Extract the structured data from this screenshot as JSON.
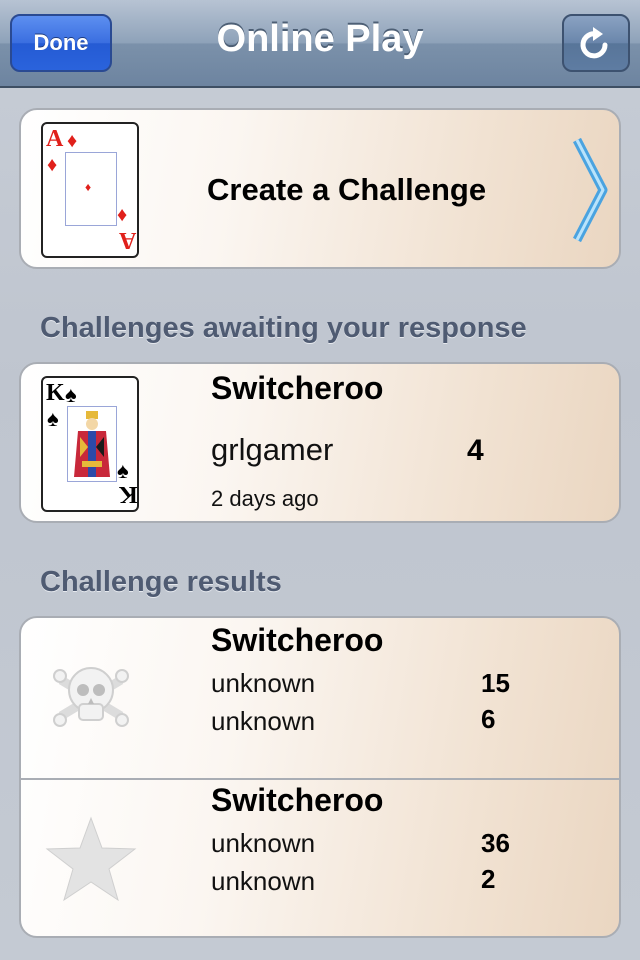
{
  "navbar": {
    "title": "Online Play",
    "done_label": "Done"
  },
  "create": {
    "label": "Create a Challenge",
    "card_rank": "A"
  },
  "awaiting": {
    "header": "Challenges awaiting your response",
    "items": [
      {
        "game": "Switcheroo",
        "player": "grlgamer",
        "score": "4",
        "time": "2 days ago",
        "card_rank": "K"
      }
    ]
  },
  "results": {
    "header": "Challenge results",
    "items": [
      {
        "game": "Switcheroo",
        "icon": "skull-crossbones-icon",
        "players": [
          {
            "name": "unknown",
            "score": "15"
          },
          {
            "name": "unknown",
            "score": "6"
          }
        ]
      },
      {
        "game": "Switcheroo",
        "icon": "star-icon",
        "players": [
          {
            "name": "unknown",
            "score": "36"
          },
          {
            "name": "unknown",
            "score": "2"
          }
        ]
      }
    ]
  },
  "colors": {
    "accent_blue": "#2a63dc",
    "suit_red": "#e0201b",
    "section_text": "#4f5b72"
  }
}
